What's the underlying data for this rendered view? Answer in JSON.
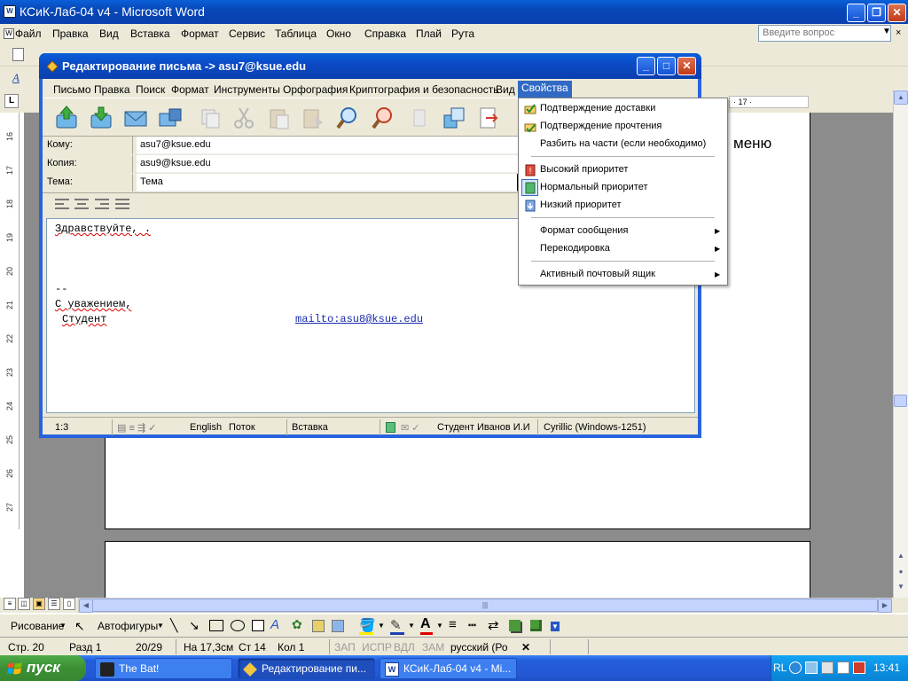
{
  "word": {
    "title": "КСиК-Лаб-04 v4 - Microsoft Word",
    "menu": [
      "Файл",
      "Правка",
      "Вид",
      "Вставка",
      "Формат",
      "Сервис",
      "Таблица",
      "Окно",
      "Справка",
      "Плай",
      "Рута"
    ],
    "ask_placeholder": "Введите вопрос",
    "doc_text": "меню",
    "ruler_mark": "· 17 ·",
    "vruler_numbers": [
      "16",
      "17",
      "18",
      "19",
      "20",
      "21",
      "22",
      "23",
      "24",
      "25",
      "26",
      "27"
    ],
    "draw_label": "Рисование",
    "autoshapes_label": "Автофигуры",
    "status": {
      "page": "Стр. 20",
      "section": "Разд 1",
      "pages": "20/29",
      "at": "На 17,3см",
      "line": "Ст 14",
      "col": "Кол 1",
      "rec": "ЗАП",
      "trk": "ИСПР",
      "ext": "ВДЛ",
      "ovr": "ЗАМ",
      "lang": "русский (Ро"
    }
  },
  "bat": {
    "title": "Редактирование письма -> asu7@ksue.edu",
    "menu": [
      "Письмо",
      "Правка",
      "Поиск",
      "Формат",
      "Инструменты",
      "Орфография",
      "Криптография и безопасность",
      "Вид",
      "Свойства"
    ],
    "fields": {
      "to_label": "Кому:",
      "to_value": "asu7@ksue.edu",
      "cc_label": "Копия:",
      "cc_value": "asu9@ksue.edu",
      "subject_label": "Тема:",
      "subject_value": "Тема"
    },
    "body": {
      "greeting": "Здравствуйте, .",
      "sig_sep": "--",
      "regards": "С уважением,",
      "name": "Студент",
      "mailto": "mailto:asu8@ksue.edu"
    },
    "status": {
      "pos": "1:3",
      "lang": "English",
      "mode": "Поток",
      "insert": "Вставка",
      "account": "Студент Иванов И.И",
      "charset": "Cyrillic (Windows-1251)"
    }
  },
  "dropdown": {
    "items": [
      {
        "label": "Подтверждение доставки",
        "icon": "delivery-confirm-icon"
      },
      {
        "label": "Подтверждение прочтения",
        "icon": "read-confirm-icon"
      },
      {
        "label": "Разбить на части (если необходимо)",
        "icon": ""
      },
      {
        "label": "Высокий приоритет",
        "icon": "high-priority-icon"
      },
      {
        "label": "Нормальный приоритет",
        "icon": "normal-priority-icon"
      },
      {
        "label": "Низкий приоритет",
        "icon": "low-priority-icon"
      },
      {
        "label": "Формат сообщения",
        "icon": ""
      },
      {
        "label": "Перекодировка",
        "icon": ""
      },
      {
        "label": "Активный почтовый ящик",
        "icon": ""
      }
    ]
  },
  "taskbar": {
    "start": "пуск",
    "buttons": [
      "The Bat!",
      "Редактирование пи...",
      "КСиК-Лаб-04 v4 - Mi..."
    ],
    "lang": "RL",
    "clock": "13:41"
  },
  "colors": {
    "xp_blue": "#0a5fd8",
    "menu_highlight": "#316ac5",
    "start_green": "#3c8f35",
    "face": "#ece9d8"
  }
}
